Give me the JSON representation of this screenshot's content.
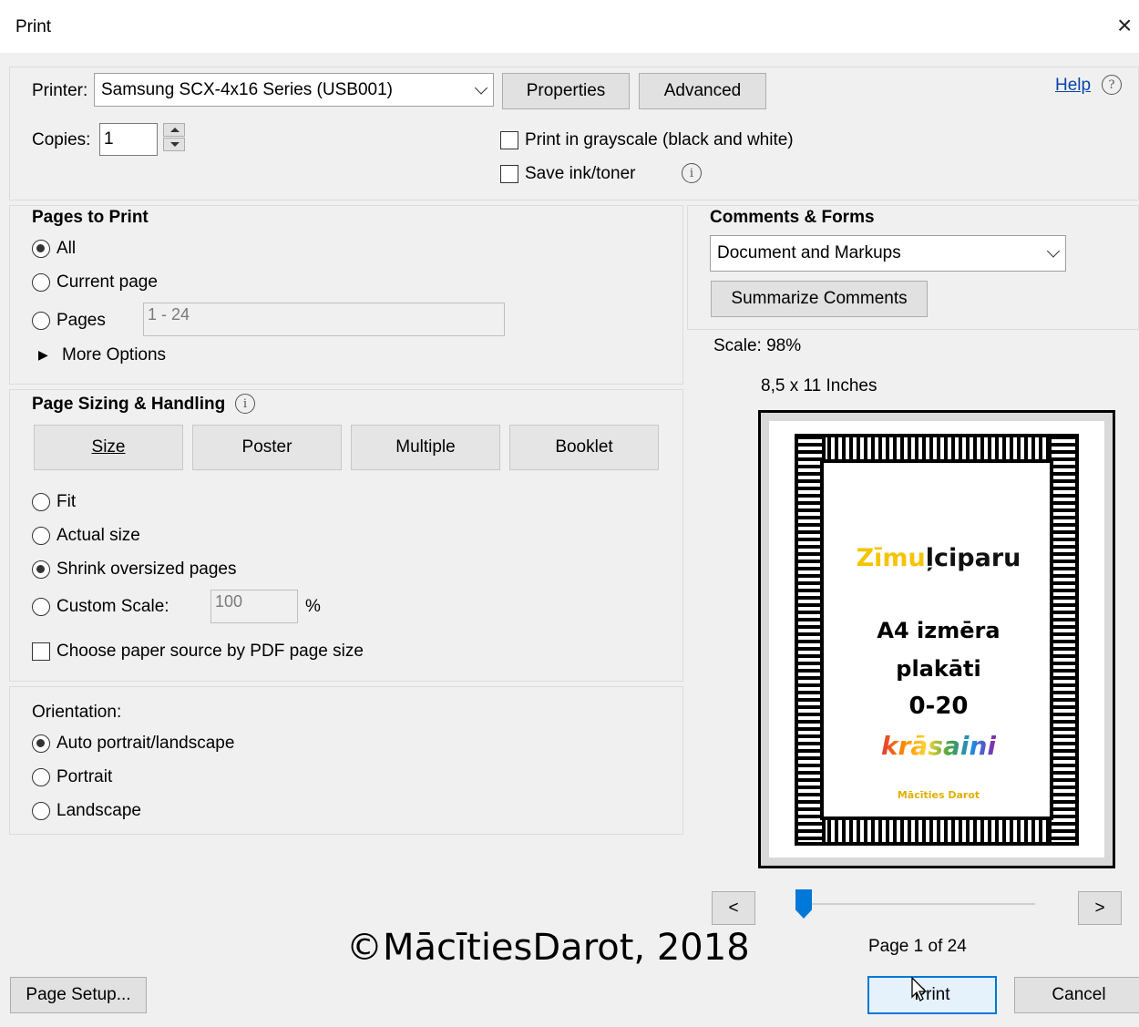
{
  "window": {
    "title": "Print",
    "close_glyph": "×"
  },
  "printer": {
    "label": "Printer:",
    "selected": "Samsung SCX-4x16 Series (USB001)",
    "properties_label": "Properties",
    "advanced_label": "Advanced",
    "help_label": "Help",
    "help_icon": "question-circle-icon",
    "copies_label": "Copies:",
    "copies_value": "1",
    "grayscale_label": "Print in grayscale (black and white)",
    "grayscale_checked": false,
    "save_ink_label": "Save ink/toner",
    "save_ink_checked": false
  },
  "pages_to_print": {
    "heading": "Pages to Print",
    "all_label": "All",
    "current_label": "Current page",
    "pages_label": "Pages",
    "pages_placeholder": "1 - 24",
    "selected": "All",
    "more_options_label": "More Options"
  },
  "page_sizing": {
    "heading": "Page Sizing & Handling",
    "tabs": [
      "Size",
      "Poster",
      "Multiple",
      "Booklet"
    ],
    "fit_label": "Fit",
    "actual_label": "Actual size",
    "shrink_label": "Shrink oversized pages",
    "custom_label": "Custom Scale:",
    "custom_value": "100",
    "percent_label": "%",
    "selected": "Shrink oversized pages",
    "paper_source_label": "Choose paper source by PDF page size",
    "paper_source_checked": false
  },
  "orientation": {
    "heading": "Orientation:",
    "auto_label": "Auto portrait/landscape",
    "portrait_label": "Portrait",
    "landscape_label": "Landscape",
    "selected": "Auto portrait/landscape"
  },
  "comments_forms": {
    "heading": "Comments & Forms",
    "selected": "Document and Markups",
    "summarize_label": "Summarize Comments"
  },
  "preview": {
    "scale_text": "Scale: 98%",
    "paper_size": "8,5 x 11 Inches",
    "poster_line1": "Zīmuļciparu",
    "poster_line2": "A4 izmēra",
    "poster_line3": "plakāti",
    "poster_line4": "0-20",
    "poster_line5": "krāsaini",
    "poster_author": "Mācīties Darot",
    "prev_label": "<",
    "next_label": ">",
    "page_info": "Page 1 of 24",
    "slider_fraction": 0.0
  },
  "footer": {
    "page_setup_label": "Page Setup...",
    "print_label": "Print",
    "cancel_label": "Cancel",
    "copyright": "©MācītiesDarot, 2018"
  },
  "colors": {
    "accent": "#0078d7",
    "link": "#0645ad",
    "dialog_bg": "#f0f0f0"
  }
}
